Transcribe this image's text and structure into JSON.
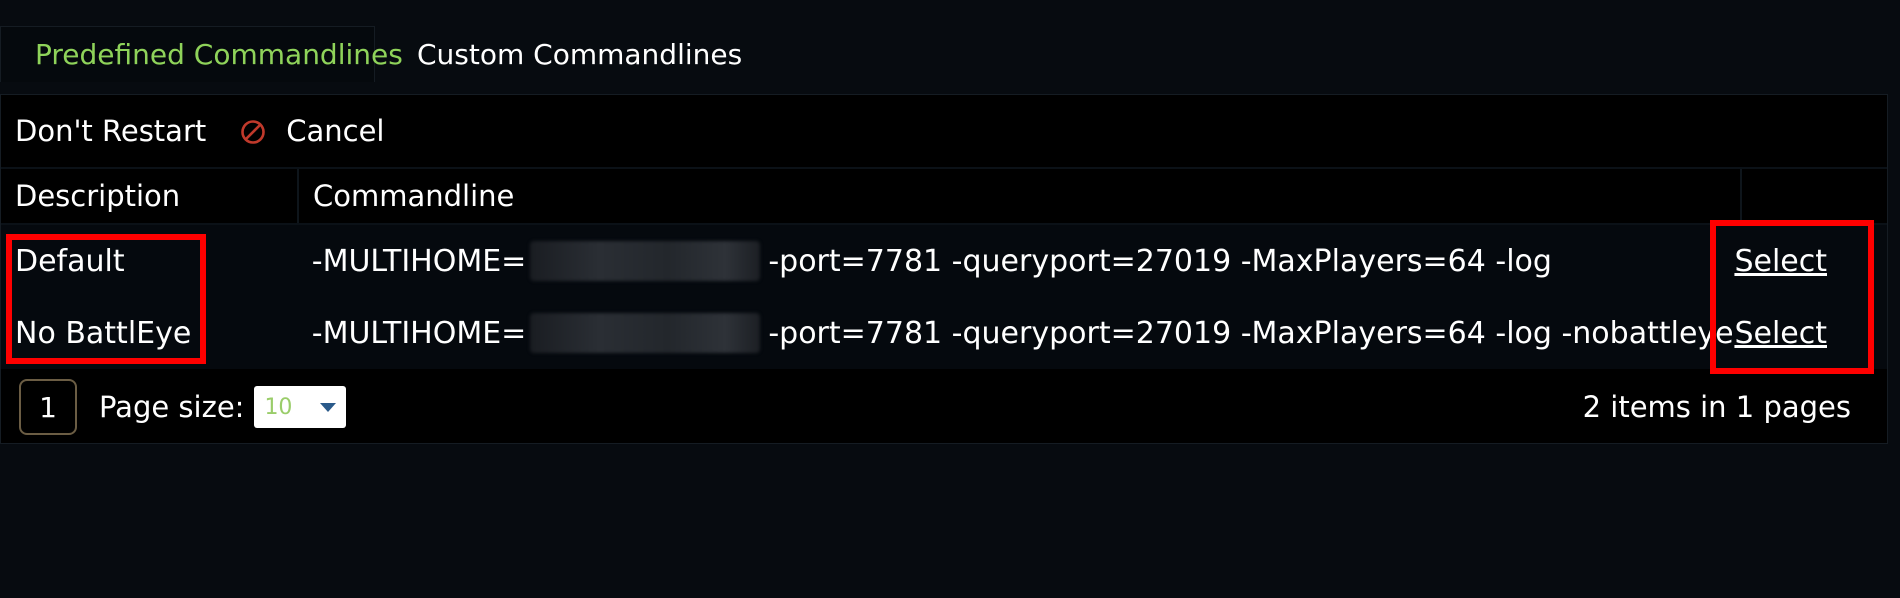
{
  "tabs": [
    {
      "label": "Predefined Commandlines",
      "active": true
    },
    {
      "label": "Custom Commandlines",
      "active": false
    }
  ],
  "toolbar": {
    "dont_restart_label": "Don't Restart",
    "cancel_label": "Cancel",
    "cancel_icon": "cancel-icon"
  },
  "table": {
    "columns": [
      "Description",
      "Commandline",
      ""
    ],
    "rows": [
      {
        "description": "Default",
        "cmd_prefix": "-MULTIHOME=",
        "cmd_suffix": "-port=7781 -queryport=27019 -MaxPlayers=64 -log",
        "action": "Select"
      },
      {
        "description": "No BattlEye",
        "cmd_prefix": "-MULTIHOME=",
        "cmd_suffix": "-port=7781 -queryport=27019 -MaxPlayers=64 -log -nobattleye",
        "action": "Select"
      }
    ]
  },
  "pager": {
    "current_page": "1",
    "page_size_label": "Page size:",
    "page_size_value": "10",
    "items_info": "2 items in 1 pages"
  },
  "colors": {
    "active_tab_text": "#8fd35a",
    "background": "#070b10",
    "highlight": "#ff0000"
  }
}
